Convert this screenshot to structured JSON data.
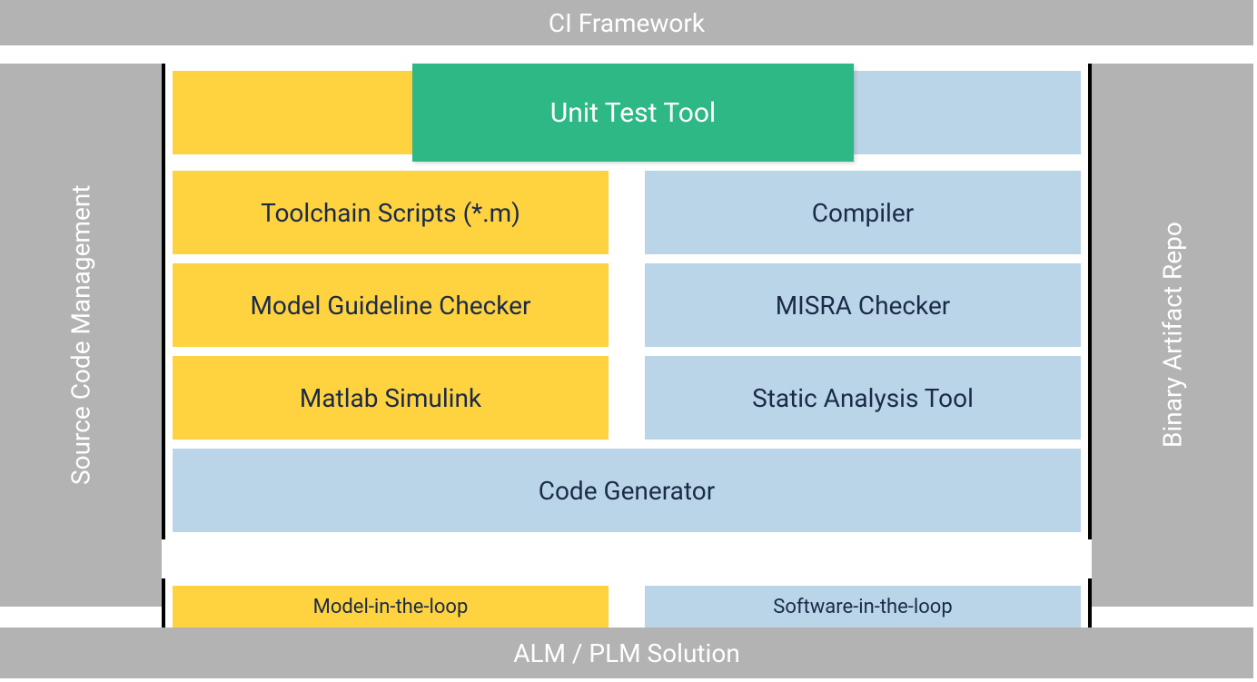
{
  "bands": {
    "top": "CI Framework",
    "bottom": "ALM / PLM Solution",
    "left": "Source Code Management",
    "right": "Binary Artifact Repo"
  },
  "top_block": {
    "label": "Unit Test Tool"
  },
  "left_col": [
    "Toolchain Scripts (*.m)",
    "Model Guideline Checker",
    "Matlab Simulink"
  ],
  "right_col": [
    "Compiler",
    "MISRA Checker",
    "Static Analysis Tool"
  ],
  "bottom_block": "Code Generator",
  "legend": {
    "left": "Model-in-the-loop",
    "right": "Software-in-the-loop"
  },
  "colors": {
    "grey": "#b3b3b3",
    "yellow": "#ffd23f",
    "blue": "#bbd5e8",
    "green": "#2eb885",
    "dark_text": "#1a2b48"
  }
}
